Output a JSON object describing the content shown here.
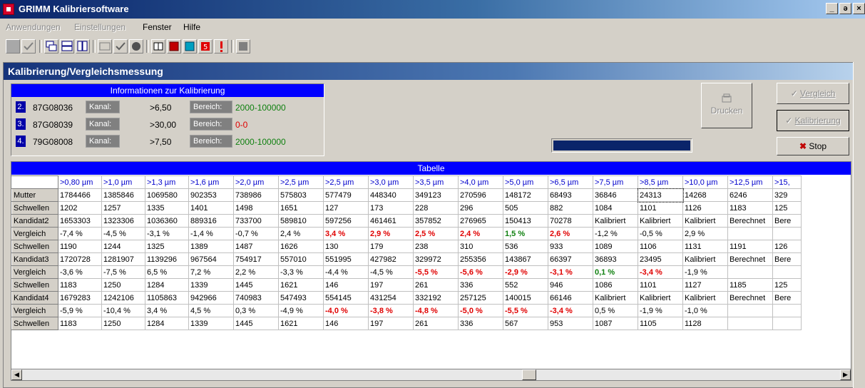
{
  "window": {
    "title": "GRIMM Kalibriersoftware",
    "controls": [
      "_",
      "ə",
      "×"
    ]
  },
  "menu": [
    {
      "label": "Anwendungen",
      "enabled": false
    },
    {
      "label": "Einstellungen",
      "enabled": false
    },
    {
      "label": "Fenster",
      "enabled": true
    },
    {
      "label": "Hilfe",
      "enabled": true
    }
  ],
  "child_window": {
    "title": "Kalibrierung/Vergleichsmessung"
  },
  "info": {
    "header": "Informationen zur Kalibrierung",
    "kanal_label": "Kanal:",
    "bereich_label": "Bereich:",
    "rows": [
      {
        "num": "2.",
        "serial": "87G08036",
        "kanal": ">6,50",
        "bereich": "2000-100000",
        "bereich_color": "#108010"
      },
      {
        "num": "3.",
        "serial": "87G08039",
        "kanal": ">30,00",
        "bereich": "0-0",
        "bereich_color": "#e00000"
      },
      {
        "num": "4.",
        "serial": "79G08008",
        "kanal": ">7,50",
        "bereich": "2000-100000",
        "bereich_color": "#108010"
      }
    ]
  },
  "buttons": {
    "drucken": "Drucken",
    "vergleich": "Vergleich",
    "kalibrierung": "Kalibrierung",
    "stop": "Stop"
  },
  "progress": {
    "value": 1.0,
    "color": "#0a246a"
  },
  "table": {
    "header": "Tabelle",
    "columns": [
      ">0,80 µm",
      ">1,0 µm",
      ">1,3 µm",
      ">1,6 µm",
      ">2,0 µm",
      ">2,5 µm",
      ">2,5 µm",
      ">3,0 µm",
      ">3,5 µm",
      ">4,0 µm",
      ">5,0 µm",
      ">6,5 µm",
      ">7,5 µm",
      ">8,5 µm",
      ">10,0 µm",
      ">12,5 µm",
      ">15,"
    ],
    "rows": [
      {
        "label": "Mutter",
        "cells": [
          "1784466",
          "1385846",
          "1069580",
          "902353",
          "738986",
          "575803",
          "577479",
          "448340",
          "349123",
          "270596",
          "148172",
          "68493",
          "36846",
          "24313",
          "14268",
          "6246",
          "329"
        ]
      },
      {
        "label": "Schwellen",
        "cells": [
          "1202",
          "1257",
          "1335",
          "1401",
          "1498",
          "1651",
          "127",
          "173",
          "228",
          "296",
          "505",
          "882",
          "1084",
          "1101",
          "1126",
          "1183",
          "125"
        ]
      },
      {
        "label": "Kandidat2",
        "cells": [
          "1653303",
          "1323306",
          "1036360",
          "889316",
          "733700",
          "589810",
          "597256",
          "461461",
          "357852",
          "276965",
          "150413",
          "70278",
          "Kalibriert",
          "Kalibriert",
          "Kalibriert",
          "Berechnet",
          "Bere"
        ]
      },
      {
        "label": "Vergleich",
        "cells": [
          "-7,4 %",
          "-4,5 %",
          "-3,1 %",
          "-1,4 %",
          "-0,7 %",
          "2,4 %",
          "3,4 %",
          "2,9 %",
          "2,5 %",
          "2,4 %",
          "1,5 %",
          "2,6 %",
          "-1,2 %",
          "-0,5 %",
          "2,9 %",
          "",
          ""
        ],
        "styles": [
          "",
          "",
          "",
          "",
          "",
          "",
          "neg",
          "neg",
          "neg",
          "neg",
          "posg",
          "neg",
          "",
          "",
          "",
          "",
          ""
        ]
      },
      {
        "label": "Schwellen",
        "cells": [
          "1190",
          "1244",
          "1325",
          "1389",
          "1487",
          "1626",
          "130",
          "179",
          "238",
          "310",
          "536",
          "933",
          "1089",
          "1106",
          "1131",
          "1191",
          "126"
        ]
      },
      {
        "label": "Kandidat3",
        "cells": [
          "1720728",
          "1281907",
          "1139296",
          "967564",
          "754917",
          "557010",
          "551995",
          "427982",
          "329972",
          "255356",
          "143867",
          "66397",
          "36893",
          "23495",
          "Kalibriert",
          "Berechnet",
          "Bere"
        ]
      },
      {
        "label": "Vergleich",
        "cells": [
          "-3,6 %",
          "-7,5 %",
          "6,5 %",
          "7,2 %",
          "2,2 %",
          "-3,3 %",
          "-4,4 %",
          "-4,5 %",
          "-5,5 %",
          "-5,6 %",
          "-2,9 %",
          "-3,1 %",
          "0,1 %",
          "-3,4 %",
          "-1,9 %",
          "",
          ""
        ],
        "styles": [
          "",
          "",
          "",
          "",
          "",
          "",
          "",
          "",
          "neg",
          "neg",
          "neg",
          "neg",
          "posg",
          "neg",
          "",
          "",
          ""
        ]
      },
      {
        "label": "Schwellen",
        "cells": [
          "1183",
          "1250",
          "1284",
          "1339",
          "1445",
          "1621",
          "146",
          "197",
          "261",
          "336",
          "552",
          "946",
          "1086",
          "1101",
          "1127",
          "1185",
          "125"
        ]
      },
      {
        "label": "Kandidat4",
        "cells": [
          "1679283",
          "1242106",
          "1105863",
          "942966",
          "740983",
          "547493",
          "554145",
          "431254",
          "332192",
          "257125",
          "140015",
          "66146",
          "Kalibriert",
          "Kalibriert",
          "Kalibriert",
          "Berechnet",
          "Bere"
        ]
      },
      {
        "label": "Vergleich",
        "cells": [
          "-5,9 %",
          "-10,4 %",
          "3,4 %",
          "4,5 %",
          "0,3 %",
          "-4,9 %",
          "-4,0 %",
          "-3,8 %",
          "-4,8 %",
          "-5,0 %",
          "-5,5 %",
          "-3,4 %",
          "0,5 %",
          "-1,9 %",
          "-1,0 %",
          "",
          ""
        ],
        "styles": [
          "",
          "",
          "",
          "",
          "",
          "",
          "neg",
          "neg",
          "neg",
          "neg",
          "neg",
          "neg",
          "",
          "",
          "",
          "",
          ""
        ]
      },
      {
        "label": "Schwellen",
        "cells": [
          "1183",
          "1250",
          "1284",
          "1339",
          "1445",
          "1621",
          "146",
          "197",
          "261",
          "336",
          "567",
          "953",
          "1087",
          "1105",
          "1128",
          "",
          ""
        ]
      }
    ]
  }
}
